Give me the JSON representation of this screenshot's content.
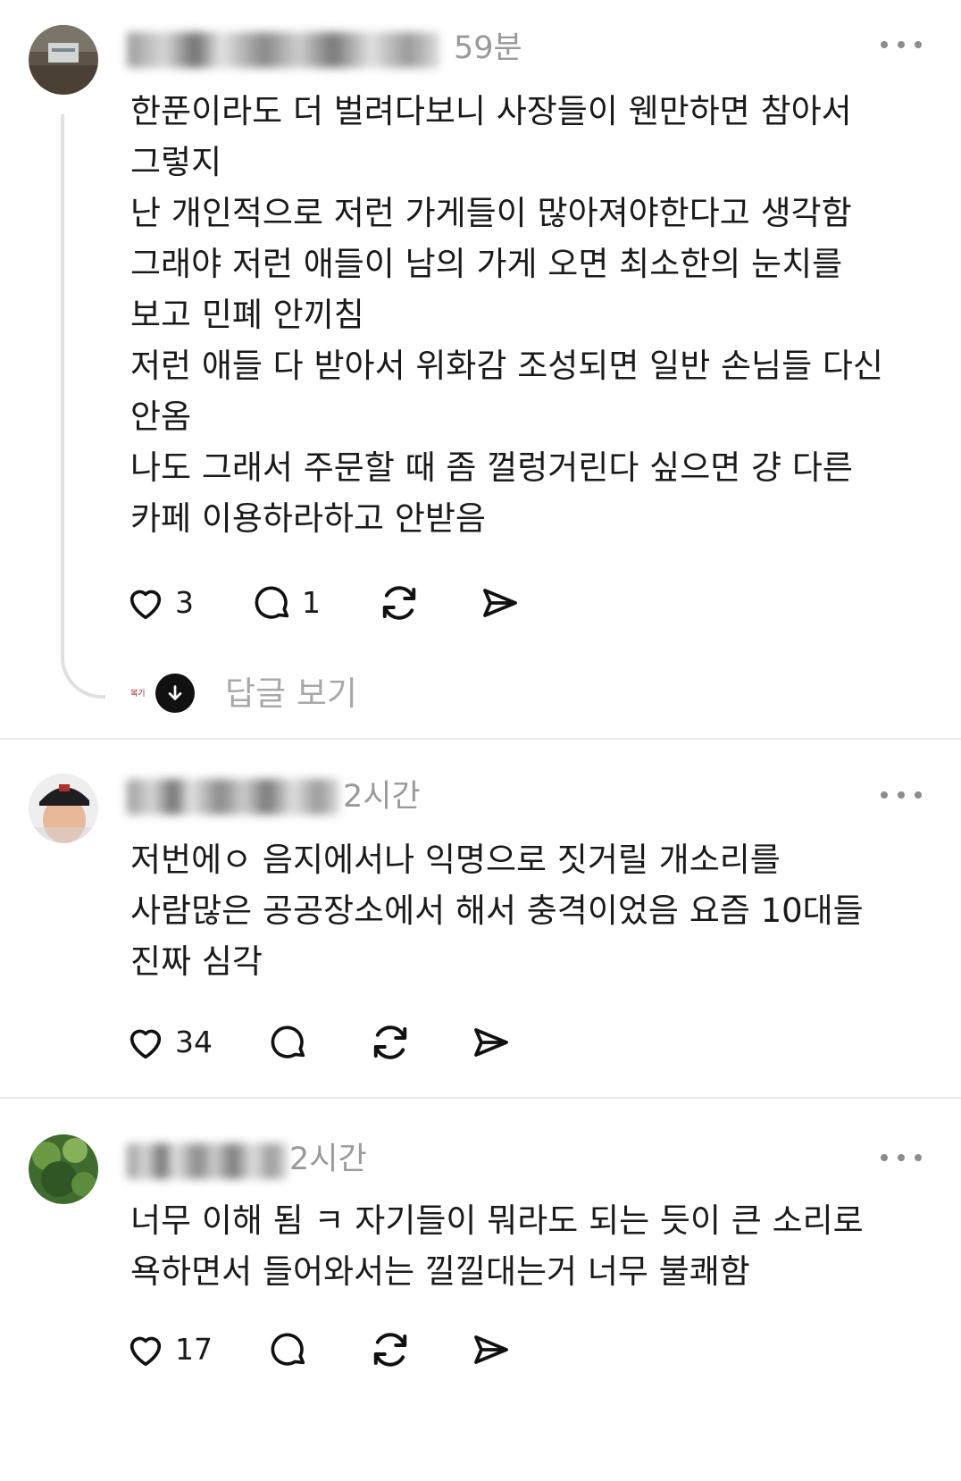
{
  "posts": [
    {
      "time": "59분",
      "lines": [
        "한푼이라도 더 벌려다보니 사장들이 웬만하면 참아서",
        "그렇지",
        "난 개인적으로 저런 가게들이 많아져야한다고 생각함",
        "그래야 저런 애들이 남의 가게 오면  최소한의 눈치를",
        "보고 민폐 안끼침",
        "저런 애들 다 받아서 위화감 조성되면  일반 손님들 다신",
        "안옴",
        "나도 그래서 주문할 때 좀 껄렁거린다 싶으면 걍 다른",
        "카페 이용하라하고 안받음"
      ],
      "likes": "3",
      "comments": "1",
      "reply_link": "답글 보기",
      "reply_avatar_text": "복기"
    },
    {
      "time": "2시간",
      "lines": [
        "저번에ㅇ 음지에서나 익명으로 짓거릴 개소리를",
        "사람많은 공공장소에서 해서 충격이었음 요즘 10대들",
        "진짜 심각"
      ],
      "likes": "34",
      "comments": ""
    },
    {
      "time": "2시간",
      "lines": [
        "너무 이해 됨 ㅋ 자기들이 뭐라도 되는 듯이 큰 소리로",
        "욕하면서 들어와서는 낄낄대는거 너무 불쾌함"
      ],
      "likes": "17",
      "comments": ""
    }
  ],
  "icons": {
    "like": "heart-icon",
    "comment": "comment-bubble-icon",
    "repost": "repost-icon",
    "share": "send-icon",
    "more": "more-options-icon",
    "expand": "arrow-down-icon"
  }
}
